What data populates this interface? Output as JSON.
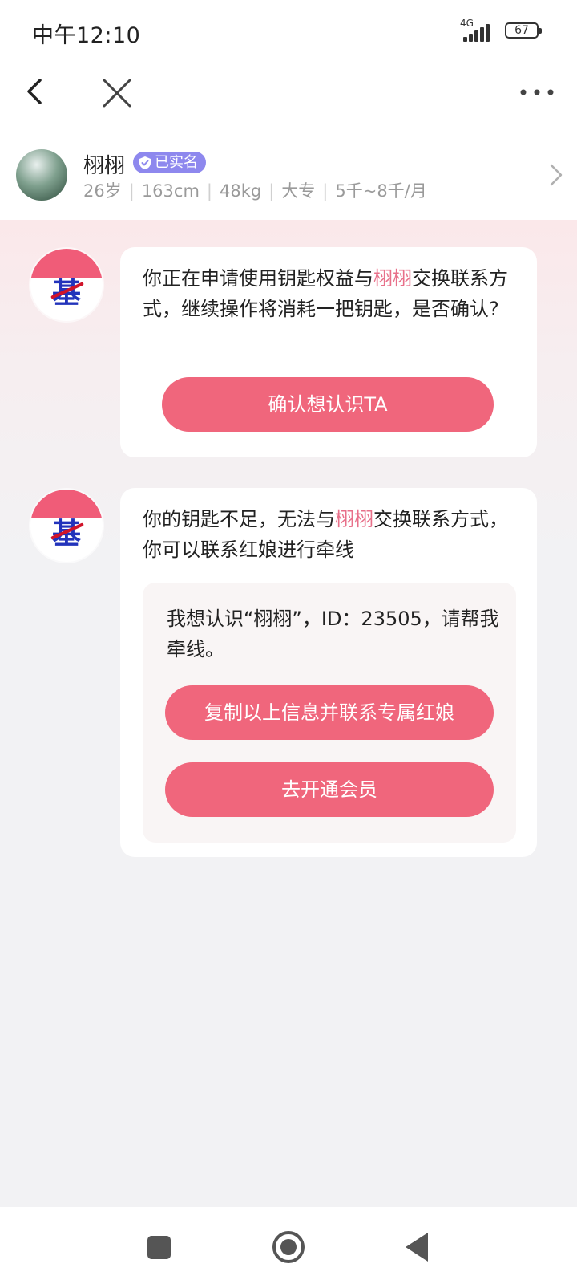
{
  "status_bar": {
    "time": "中午12:10",
    "network": "4G",
    "battery": "67"
  },
  "nav": {
    "back_icon": "chevron-left-icon",
    "close_icon": "close-icon",
    "more_icon": "more-horizontal-icon"
  },
  "profile": {
    "name": "栩栩",
    "badge": "已实名",
    "age": "26岁",
    "height": "163cm",
    "weight": "48kg",
    "education": "大专",
    "income": "5千~8千/月"
  },
  "messages": [
    {
      "text_before": "你正在申请使用钥匙权益与",
      "highlight": "栩栩",
      "text_after": "交换联系方式，继续操作将消耗一把钥匙，是否确认?",
      "button": "确认想认识TA"
    },
    {
      "text_before": "你的钥匙不足，无法与",
      "highlight": "栩栩",
      "text_after": "交换联系方式，你可以联系红娘进行牵线",
      "card_text": "我想认识“栩栩”，ID：23505，请帮我牵线。",
      "button_copy": "复制以上信息并联系专属红娘",
      "button_vip": "去开通会员"
    }
  ],
  "bot_avatar_text": "基",
  "colors": {
    "accent": "#f0667c",
    "highlight": "#e8708a",
    "badge": "#8e88ee"
  },
  "system_nav": {
    "recents_icon": "square-icon",
    "home_icon": "circle-icon",
    "back_icon": "triangle-back-icon"
  }
}
